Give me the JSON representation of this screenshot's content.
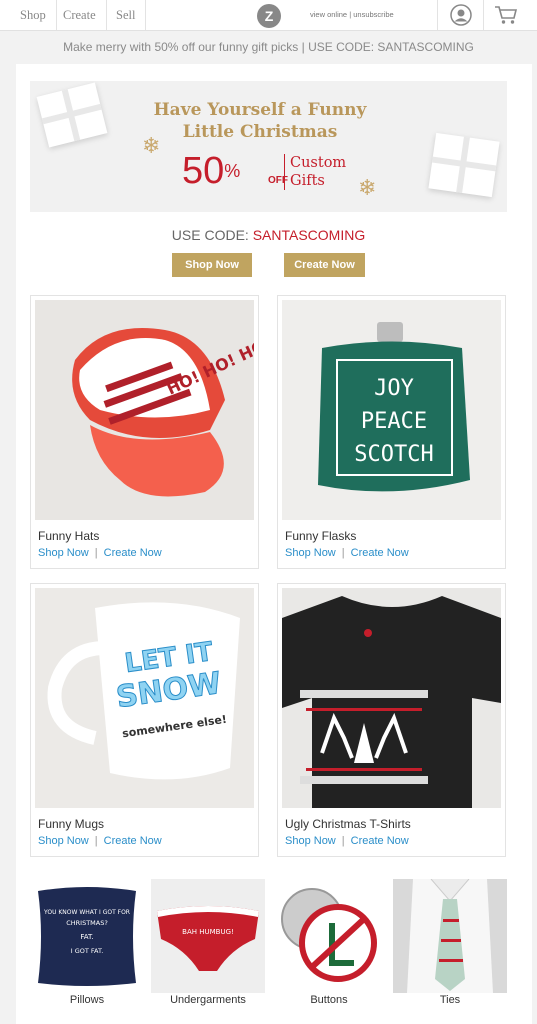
{
  "nav": {
    "shop": "Shop",
    "create": "Create",
    "sell": "Sell",
    "logo": "Z",
    "view_online": "view online",
    "unsubscribe": "unsubscribe",
    "link_sep": "|"
  },
  "promo": "Make merry with 50% off our funny gift picks | USE CODE: SANTASCOMING",
  "hero": {
    "title_line1": "Have Yourself a Funny",
    "title_line2": "Little Christmas",
    "percent": "50",
    "percent_sign": "%",
    "off": "OFF",
    "custom_line1": "Custom",
    "custom_line2": "Gifts"
  },
  "code": {
    "label": "USE CODE:",
    "value": "SANTASCOMING"
  },
  "buttons": {
    "shop": "Shop Now",
    "create": "Create Now"
  },
  "products": [
    {
      "title": "Funny Hats",
      "shop": "Shop Now",
      "sep": "|",
      "create": "Create Now",
      "art": "HO! HO! HO!"
    },
    {
      "title": "Funny Flasks",
      "shop": "Shop Now",
      "sep": "|",
      "create": "Create Now",
      "art": [
        "JOY",
        "PEACE",
        "SCOTCH"
      ]
    },
    {
      "title": "Funny Mugs",
      "shop": "Shop Now",
      "sep": "|",
      "create": "Create Now",
      "art": [
        "LET IT",
        "SNOW",
        "somewhere else!"
      ]
    },
    {
      "title": "Ugly Christmas T-Shirts",
      "shop": "Shop Now",
      "sep": "|",
      "create": "Create Now"
    }
  ],
  "categories": [
    {
      "label": "Pillows",
      "art": [
        "YOU KNOW WHAT I GOT FOR",
        "CHRISTMAS?",
        "FAT.",
        "I GOT FAT."
      ]
    },
    {
      "label": "Undergarments",
      "art": "BAH HUMBUG!"
    },
    {
      "label": "Buttons"
    },
    {
      "label": "Ties"
    }
  ],
  "colors": {
    "accent_gold": "#c0a460",
    "brand_red": "#c51e2b",
    "link_blue": "#2a8ec9"
  }
}
